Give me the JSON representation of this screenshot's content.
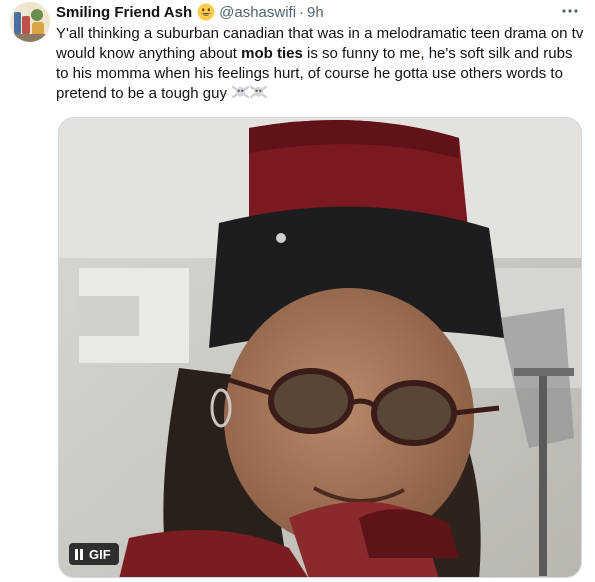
{
  "tweet": {
    "display_name": "Smiling Friend Ash",
    "badge_icon": "grinning-face-emoji-icon",
    "handle": "@ashaswifi",
    "separator": "·",
    "time": "9h",
    "more_icon": "more-dots-icon",
    "text_before_bold": "Y'all thinking a suburban canadian that was in a melodramatic teen drama on tv would know anything about ",
    "text_bold": "mob ties",
    "text_after_bold": " is so funny to me, he's soft silk and rubs to his momma when his feelings hurt, of course he gotta use others words to pretend to be a tough guy",
    "trailing_icons": [
      "skull-crossbones-emoji-icon",
      "skull-crossbones-emoji-icon"
    ]
  },
  "media": {
    "type": "gif",
    "badge_label": "GIF",
    "pause_icon": "pause-icon"
  },
  "colors": {
    "text": "#0f1419",
    "secondary": "#536471",
    "border": "#cfd9de"
  }
}
